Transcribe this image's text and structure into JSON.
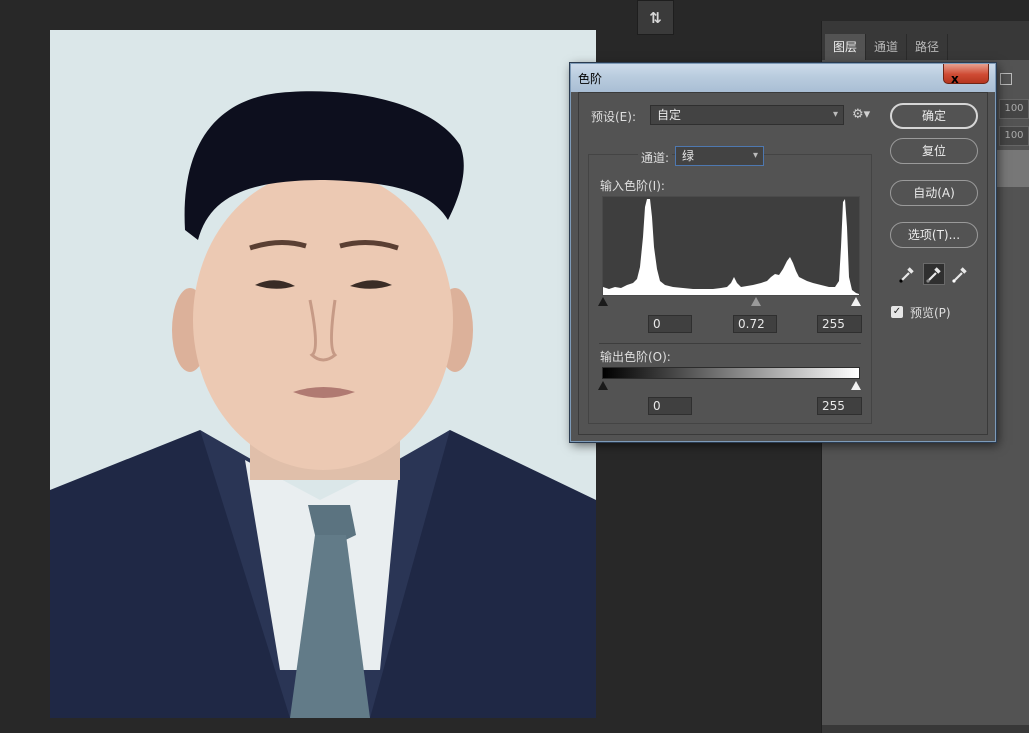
{
  "toolbar": {
    "top_button_glyph": "⇅"
  },
  "right_panel": {
    "tabs": [
      {
        "label": "图层",
        "active": true
      },
      {
        "label": "通道",
        "active": false
      },
      {
        "label": "路径",
        "active": false
      }
    ],
    "fields": [
      "100",
      "100"
    ]
  },
  "dialog": {
    "title": "色阶",
    "close_label": "x",
    "preset": {
      "label": "预设(E):",
      "value": "自定"
    },
    "channel": {
      "label": "通道:",
      "value": "绿"
    },
    "input_levels": {
      "label": "输入色阶(I):",
      "black": "0",
      "gamma": "0.72",
      "white": "255"
    },
    "output_levels": {
      "label": "输出色阶(O):",
      "black": "0",
      "white": "255"
    },
    "buttons": {
      "ok": "确定",
      "reset": "复位",
      "auto": "自动(A)",
      "options": "选项(T)..."
    },
    "preview": {
      "label": "预览(P)",
      "checked": true
    }
  },
  "colors": {
    "dialog_bg": "#535353",
    "title_bar": "#b9ccde",
    "close_button": "#cf4b34",
    "canvas_bg": "#282828",
    "suit": "#1f2845",
    "tie": "#5e7684"
  }
}
